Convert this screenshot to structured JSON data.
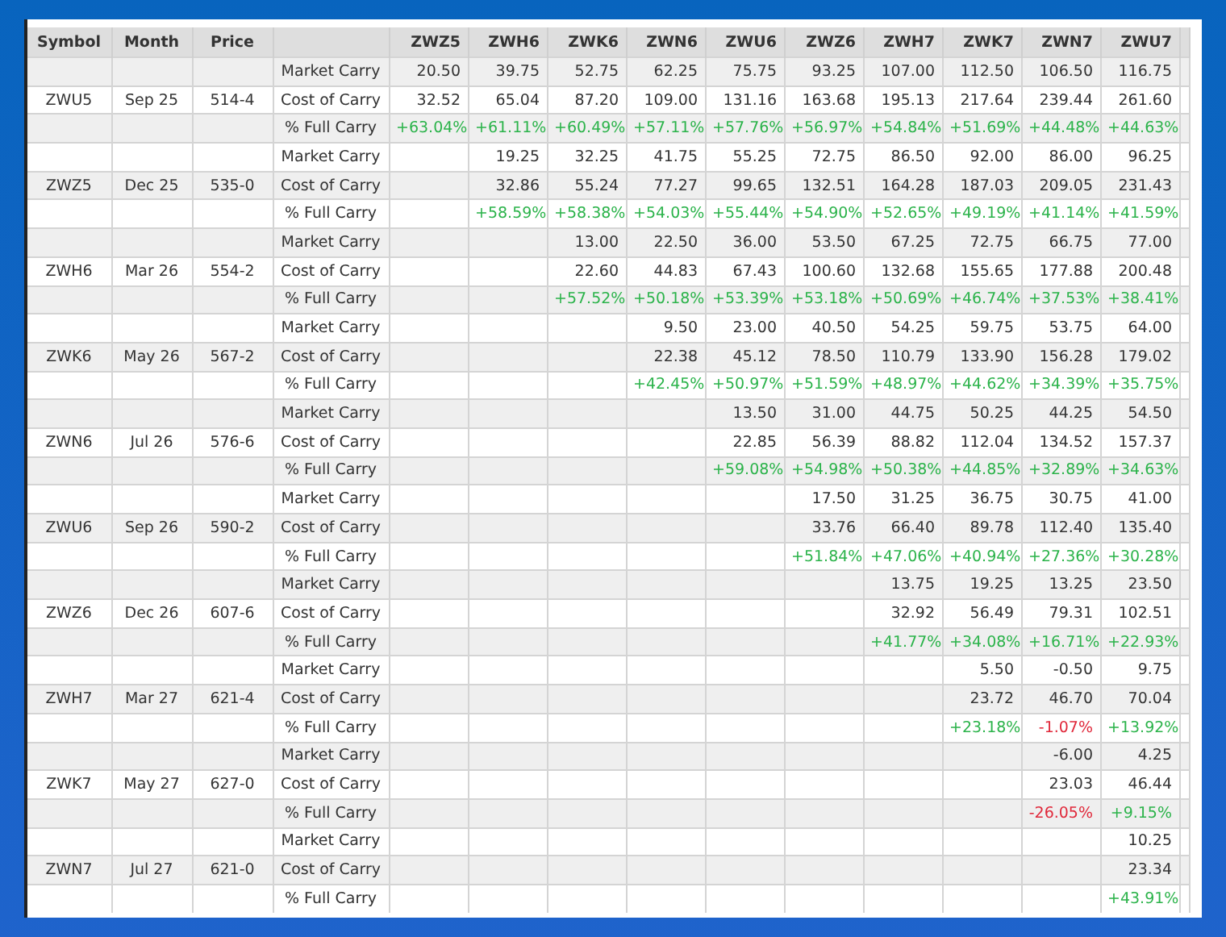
{
  "table": {
    "columns": [
      "Symbol",
      "Month",
      "Price",
      "ZWZ5",
      "ZWH6",
      "ZWK6",
      "ZWN6",
      "ZWU6",
      "ZWZ6",
      "ZWH7",
      "ZWK7",
      "ZWN7",
      "ZWU7"
    ],
    "groups": [
      {
        "symbol": "ZWU5",
        "month": "Sep 25",
        "price": "514-4",
        "rows": [
          {
            "label": "Market Carry",
            "kind": "plain",
            "cells": [
              "20.50",
              "39.75",
              "52.75",
              "62.25",
              "75.75",
              "93.25",
              "107.00",
              "112.50",
              "106.50",
              "116.75"
            ]
          },
          {
            "label": "Cost of Carry",
            "kind": "plain",
            "cells": [
              "32.52",
              "65.04",
              "87.20",
              "109.00",
              "131.16",
              "163.68",
              "195.13",
              "217.64",
              "239.44",
              "261.60"
            ]
          },
          {
            "label": "% Full Carry",
            "kind": "percent",
            "cells": [
              {
                "text": "+63.04%",
                "negative": false
              },
              {
                "text": "+61.11%",
                "negative": false
              },
              {
                "text": "+60.49%",
                "negative": false
              },
              {
                "text": "+57.11%",
                "negative": false
              },
              {
                "text": "+57.76%",
                "negative": false
              },
              {
                "text": "+56.97%",
                "negative": false
              },
              {
                "text": "+54.84%",
                "negative": false
              },
              {
                "text": "+51.69%",
                "negative": false
              },
              {
                "text": "+44.48%",
                "negative": false
              },
              {
                "text": "+44.63%",
                "negative": false
              }
            ]
          }
        ]
      },
      {
        "symbol": "ZWZ5",
        "month": "Dec 25",
        "price": "535-0",
        "rows": [
          {
            "label": "Market Carry",
            "kind": "plain",
            "cells": [
              null,
              "19.25",
              "32.25",
              "41.75",
              "55.25",
              "72.75",
              "86.50",
              "92.00",
              "86.00",
              "96.25"
            ]
          },
          {
            "label": "Cost of Carry",
            "kind": "plain",
            "cells": [
              null,
              "32.86",
              "55.24",
              "77.27",
              "99.65",
              "132.51",
              "164.28",
              "187.03",
              "209.05",
              "231.43"
            ]
          },
          {
            "label": "% Full Carry",
            "kind": "percent",
            "cells": [
              null,
              {
                "text": "+58.59%",
                "negative": false
              },
              {
                "text": "+58.38%",
                "negative": false
              },
              {
                "text": "+54.03%",
                "negative": false
              },
              {
                "text": "+55.44%",
                "negative": false
              },
              {
                "text": "+54.90%",
                "negative": false
              },
              {
                "text": "+52.65%",
                "negative": false
              },
              {
                "text": "+49.19%",
                "negative": false
              },
              {
                "text": "+41.14%",
                "negative": false
              },
              {
                "text": "+41.59%",
                "negative": false
              }
            ]
          }
        ]
      },
      {
        "symbol": "ZWH6",
        "month": "Mar 26",
        "price": "554-2",
        "rows": [
          {
            "label": "Market Carry",
            "kind": "plain",
            "cells": [
              null,
              null,
              "13.00",
              "22.50",
              "36.00",
              "53.50",
              "67.25",
              "72.75",
              "66.75",
              "77.00"
            ]
          },
          {
            "label": "Cost of Carry",
            "kind": "plain",
            "cells": [
              null,
              null,
              "22.60",
              "44.83",
              "67.43",
              "100.60",
              "132.68",
              "155.65",
              "177.88",
              "200.48"
            ]
          },
          {
            "label": "% Full Carry",
            "kind": "percent",
            "cells": [
              null,
              null,
              {
                "text": "+57.52%",
                "negative": false
              },
              {
                "text": "+50.18%",
                "negative": false
              },
              {
                "text": "+53.39%",
                "negative": false
              },
              {
                "text": "+53.18%",
                "negative": false
              },
              {
                "text": "+50.69%",
                "negative": false
              },
              {
                "text": "+46.74%",
                "negative": false
              },
              {
                "text": "+37.53%",
                "negative": false
              },
              {
                "text": "+38.41%",
                "negative": false
              }
            ]
          }
        ]
      },
      {
        "symbol": "ZWK6",
        "month": "May 26",
        "price": "567-2",
        "rows": [
          {
            "label": "Market Carry",
            "kind": "plain",
            "cells": [
              null,
              null,
              null,
              "9.50",
              "23.00",
              "40.50",
              "54.25",
              "59.75",
              "53.75",
              "64.00"
            ]
          },
          {
            "label": "Cost of Carry",
            "kind": "plain",
            "cells": [
              null,
              null,
              null,
              "22.38",
              "45.12",
              "78.50",
              "110.79",
              "133.90",
              "156.28",
              "179.02"
            ]
          },
          {
            "label": "% Full Carry",
            "kind": "percent",
            "cells": [
              null,
              null,
              null,
              {
                "text": "+42.45%",
                "negative": false
              },
              {
                "text": "+50.97%",
                "negative": false
              },
              {
                "text": "+51.59%",
                "negative": false
              },
              {
                "text": "+48.97%",
                "negative": false
              },
              {
                "text": "+44.62%",
                "negative": false
              },
              {
                "text": "+34.39%",
                "negative": false
              },
              {
                "text": "+35.75%",
                "negative": false
              }
            ]
          }
        ]
      },
      {
        "symbol": "ZWN6",
        "month": "Jul 26",
        "price": "576-6",
        "rows": [
          {
            "label": "Market Carry",
            "kind": "plain",
            "cells": [
              null,
              null,
              null,
              null,
              "13.50",
              "31.00",
              "44.75",
              "50.25",
              "44.25",
              "54.50"
            ]
          },
          {
            "label": "Cost of Carry",
            "kind": "plain",
            "cells": [
              null,
              null,
              null,
              null,
              "22.85",
              "56.39",
              "88.82",
              "112.04",
              "134.52",
              "157.37"
            ]
          },
          {
            "label": "% Full Carry",
            "kind": "percent",
            "cells": [
              null,
              null,
              null,
              null,
              {
                "text": "+59.08%",
                "negative": false
              },
              {
                "text": "+54.98%",
                "negative": false
              },
              {
                "text": "+50.38%",
                "negative": false
              },
              {
                "text": "+44.85%",
                "negative": false
              },
              {
                "text": "+32.89%",
                "negative": false
              },
              {
                "text": "+34.63%",
                "negative": false
              }
            ]
          }
        ]
      },
      {
        "symbol": "ZWU6",
        "month": "Sep 26",
        "price": "590-2",
        "rows": [
          {
            "label": "Market Carry",
            "kind": "plain",
            "cells": [
              null,
              null,
              null,
              null,
              null,
              "17.50",
              "31.25",
              "36.75",
              "30.75",
              "41.00"
            ]
          },
          {
            "label": "Cost of Carry",
            "kind": "plain",
            "cells": [
              null,
              null,
              null,
              null,
              null,
              "33.76",
              "66.40",
              "89.78",
              "112.40",
              "135.40"
            ]
          },
          {
            "label": "% Full Carry",
            "kind": "percent",
            "cells": [
              null,
              null,
              null,
              null,
              null,
              {
                "text": "+51.84%",
                "negative": false
              },
              {
                "text": "+47.06%",
                "negative": false
              },
              {
                "text": "+40.94%",
                "negative": false
              },
              {
                "text": "+27.36%",
                "negative": false
              },
              {
                "text": "+30.28%",
                "negative": false
              }
            ]
          }
        ]
      },
      {
        "symbol": "ZWZ6",
        "month": "Dec 26",
        "price": "607-6",
        "rows": [
          {
            "label": "Market Carry",
            "kind": "plain",
            "cells": [
              null,
              null,
              null,
              null,
              null,
              null,
              "13.75",
              "19.25",
              "13.25",
              "23.50"
            ]
          },
          {
            "label": "Cost of Carry",
            "kind": "plain",
            "cells": [
              null,
              null,
              null,
              null,
              null,
              null,
              "32.92",
              "56.49",
              "79.31",
              "102.51"
            ]
          },
          {
            "label": "% Full Carry",
            "kind": "percent",
            "cells": [
              null,
              null,
              null,
              null,
              null,
              null,
              {
                "text": "+41.77%",
                "negative": false
              },
              {
                "text": "+34.08%",
                "negative": false
              },
              {
                "text": "+16.71%",
                "negative": false
              },
              {
                "text": "+22.93%",
                "negative": false
              }
            ]
          }
        ]
      },
      {
        "symbol": "ZWH7",
        "month": "Mar 27",
        "price": "621-4",
        "rows": [
          {
            "label": "Market Carry",
            "kind": "plain",
            "cells": [
              null,
              null,
              null,
              null,
              null,
              null,
              null,
              "5.50",
              "-0.50",
              "9.75"
            ]
          },
          {
            "label": "Cost of Carry",
            "kind": "plain",
            "cells": [
              null,
              null,
              null,
              null,
              null,
              null,
              null,
              "23.72",
              "46.70",
              "70.04"
            ]
          },
          {
            "label": "% Full Carry",
            "kind": "percent",
            "cells": [
              null,
              null,
              null,
              null,
              null,
              null,
              null,
              {
                "text": "+23.18%",
                "negative": false
              },
              {
                "text": "-1.07%",
                "negative": true
              },
              {
                "text": "+13.92%",
                "negative": false
              }
            ]
          }
        ]
      },
      {
        "symbol": "ZWK7",
        "month": "May 27",
        "price": "627-0",
        "rows": [
          {
            "label": "Market Carry",
            "kind": "plain",
            "cells": [
              null,
              null,
              null,
              null,
              null,
              null,
              null,
              null,
              "-6.00",
              "4.25"
            ]
          },
          {
            "label": "Cost of Carry",
            "kind": "plain",
            "cells": [
              null,
              null,
              null,
              null,
              null,
              null,
              null,
              null,
              "23.03",
              "46.44"
            ]
          },
          {
            "label": "% Full Carry",
            "kind": "percent",
            "cells": [
              null,
              null,
              null,
              null,
              null,
              null,
              null,
              null,
              {
                "text": "-26.05%",
                "negative": true
              },
              {
                "text": "+9.15%",
                "negative": false
              }
            ]
          }
        ]
      },
      {
        "symbol": "ZWN7",
        "month": "Jul 27",
        "price": "621-0",
        "rows": [
          {
            "label": "Market Carry",
            "kind": "plain",
            "cells": [
              null,
              null,
              null,
              null,
              null,
              null,
              null,
              null,
              null,
              "10.25"
            ]
          },
          {
            "label": "Cost of Carry",
            "kind": "plain",
            "cells": [
              null,
              null,
              null,
              null,
              null,
              null,
              null,
              null,
              null,
              "23.34"
            ]
          },
          {
            "label": "% Full Carry",
            "kind": "percent",
            "cells": [
              null,
              null,
              null,
              null,
              null,
              null,
              null,
              null,
              null,
              {
                "text": "+43.91%",
                "negative": false
              }
            ]
          }
        ]
      }
    ]
  }
}
